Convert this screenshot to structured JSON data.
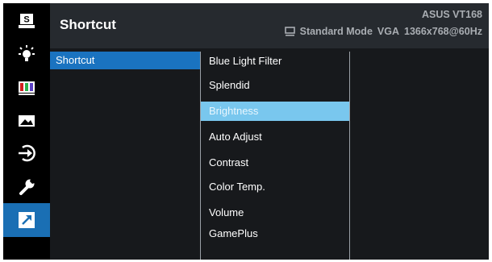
{
  "header": {
    "title": "Shortcut",
    "model": "ASUS VT168",
    "mode": "Standard Mode",
    "input": "VGA",
    "resolution": "1366x768@60Hz"
  },
  "sidebar": {
    "icons": [
      "system-setup-icon",
      "bluelight-icon",
      "color-icon",
      "image-icon",
      "input-select-icon",
      "wrench-icon",
      "shortcut-icon"
    ],
    "active_index": 6
  },
  "menu": {
    "category": "Shortcut",
    "items": [
      "Blue Light Filter",
      "Splendid",
      "Brightness",
      "Auto Adjust",
      "Contrast",
      "Color Temp.",
      "Volume",
      "GamePlus"
    ],
    "selected_index": 2
  },
  "colors": {
    "active_rail": "#1a6fb4",
    "category_highlight": "#1a73c0",
    "item_highlight": "#79c7ee"
  }
}
